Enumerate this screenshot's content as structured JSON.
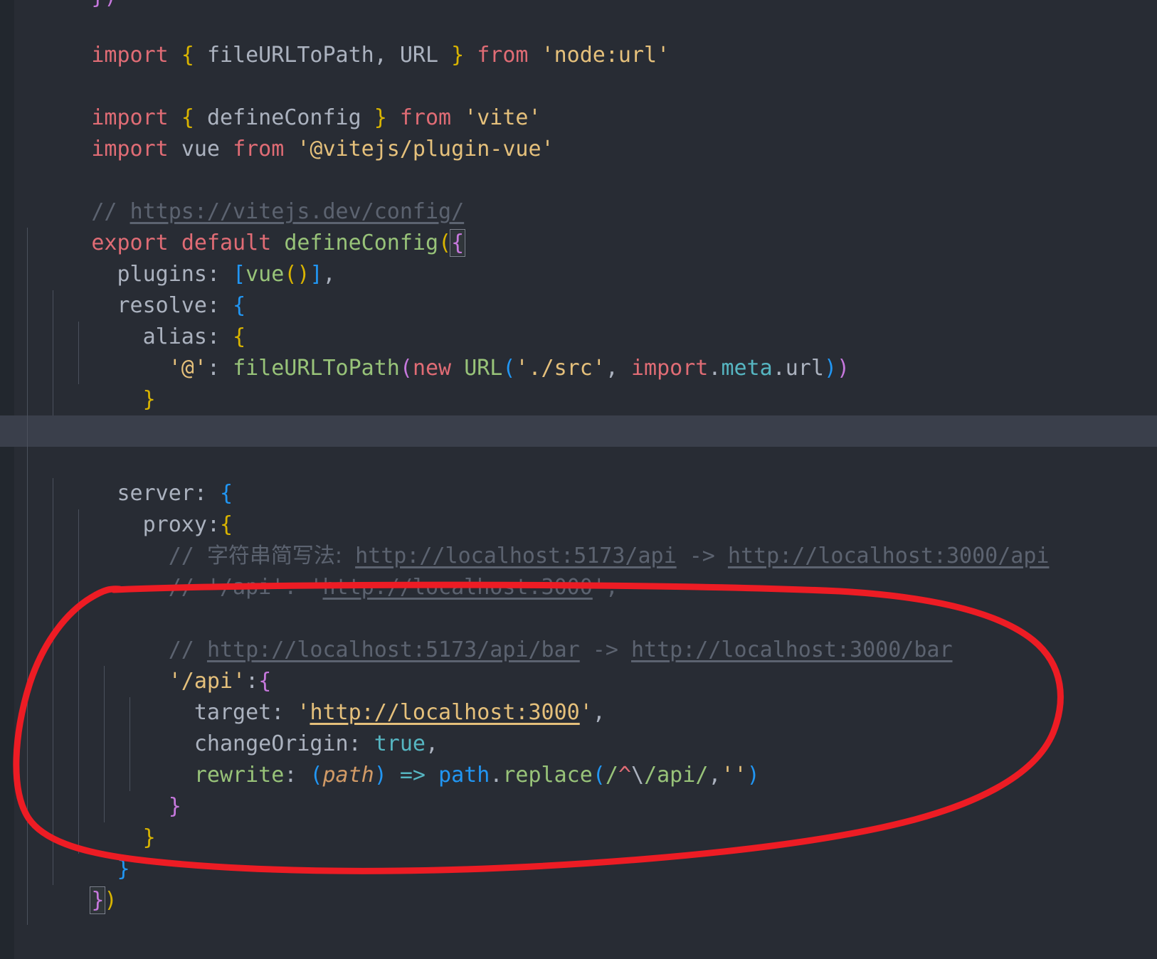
{
  "app": {
    "kind": "code-editor",
    "theme": "one-dark",
    "language": "javascript",
    "file_kind": "vite.config.js"
  },
  "colors": {
    "editor_background": "#282c34",
    "gutter_background": "#22272e",
    "selected_line_background": "#3a3f4b",
    "annotation_red": "#ed1c24",
    "keyword": "#e06c75",
    "string": "#e5c07b",
    "comment": "#5c6370",
    "function": "#98c379",
    "boolean": "#56b6c2",
    "bracket_yellow": "#d9b400",
    "bracket_pink": "#c678dd",
    "bracket_blue": "#2196f3",
    "text": "#abb2bf"
  },
  "annotation": {
    "name": "red-ellipse-highlight",
    "shape": "hand-drawn-ellipse",
    "color": "#ed1c24",
    "stroke_width": 9,
    "encloses_lines": [
      13,
      14,
      15,
      16,
      17,
      18,
      19,
      20
    ]
  },
  "code": {
    "lines": [
      {
        "n": 0,
        "indent": 0,
        "text": "})",
        "kind": "partial-top"
      },
      {
        "n": 1,
        "indent": 0,
        "text": "import { fileURLToPath, URL } from 'node:url'"
      },
      {
        "n": 2,
        "indent": 0,
        "text": ""
      },
      {
        "n": 3,
        "indent": 0,
        "text": "import { defineConfig } from 'vite'"
      },
      {
        "n": 4,
        "indent": 0,
        "text": "import vue from '@vitejs/plugin-vue'"
      },
      {
        "n": 5,
        "indent": 0,
        "text": ""
      },
      {
        "n": 6,
        "indent": 0,
        "text": "// https://vitejs.dev/config/"
      },
      {
        "n": 7,
        "indent": 0,
        "text": "export default defineConfig({"
      },
      {
        "n": 8,
        "indent": 1,
        "text": "plugins: [vue()],"
      },
      {
        "n": 9,
        "indent": 1,
        "text": "resolve: {"
      },
      {
        "n": 10,
        "indent": 2,
        "text": "alias: {"
      },
      {
        "n": 11,
        "indent": 3,
        "text": "'@': fileURLToPath(new URL('./src', import.meta.url))"
      },
      {
        "n": 12,
        "indent": 2,
        "text": "}"
      },
      {
        "n": 13,
        "indent": 1,
        "text": "},"
      },
      {
        "n": 14,
        "indent": 1,
        "text": "",
        "selected": true
      },
      {
        "n": 15,
        "indent": 1,
        "text": "server: {"
      },
      {
        "n": 16,
        "indent": 2,
        "text": "proxy:{"
      },
      {
        "n": 17,
        "indent": 3,
        "text": "// 字符串简写法: http://localhost:5173/api -> http://localhost:3000/api"
      },
      {
        "n": 18,
        "indent": 3,
        "text": "// '/api': 'http://localhost:3000',"
      },
      {
        "n": 19,
        "indent": 3,
        "text": ""
      },
      {
        "n": 20,
        "indent": 3,
        "text": "// http://localhost:5173/api/bar -> http://localhost:3000/bar"
      },
      {
        "n": 21,
        "indent": 3,
        "text": "'/api':{"
      },
      {
        "n": 22,
        "indent": 4,
        "text": "target: 'http://localhost:3000',"
      },
      {
        "n": 23,
        "indent": 4,
        "text": "changeOrigin: true,"
      },
      {
        "n": 24,
        "indent": 4,
        "text": "rewrite: (path) => path.replace(/^\\/api/,'')"
      },
      {
        "n": 25,
        "indent": 3,
        "text": "}"
      },
      {
        "n": 26,
        "indent": 2,
        "text": "}"
      },
      {
        "n": 27,
        "indent": 1,
        "text": "}"
      },
      {
        "n": 28,
        "indent": 0,
        "text": "})"
      }
    ],
    "tokens": {
      "kw_import": "import",
      "kw_from": "from",
      "kw_export": "export",
      "kw_default": "default",
      "kw_new": "new",
      "id_fileURLToPath": "fileURLToPath",
      "id_URL": "URL",
      "id_defineConfig": "defineConfig",
      "id_vue": "vue",
      "id_plugins": "plugins",
      "id_resolve": "resolve",
      "id_alias": "alias",
      "id_server": "server",
      "id_proxy": "proxy",
      "id_target": "target",
      "id_changeOrigin": "changeOrigin",
      "id_rewrite": "rewrite",
      "id_path": "path",
      "id_replace": "replace",
      "id_import_meta_url": "import.meta.url",
      "str_node_url": "'node:url'",
      "str_vite": "'vite'",
      "str_plugin_vue": "'@vitejs/plugin-vue'",
      "str_src": "'./src'",
      "str_at": "'@'",
      "str_api_key": "'/api'",
      "str_localhost_3000": "'http://localhost:3000'",
      "str_empty": "''",
      "bool_true": "true",
      "regex_api": "/^\\/api/",
      "comment_config_url": "// https://vitejs.dev/config/",
      "comment_cn": "// 字符串简写法: http://localhost:5173/api -> http://localhost:3000/api",
      "comment_api_short": "// '/api': 'http://localhost:3000',",
      "comment_bar": "// http://localhost:5173/api/bar -> http://localhost:3000/bar"
    }
  }
}
